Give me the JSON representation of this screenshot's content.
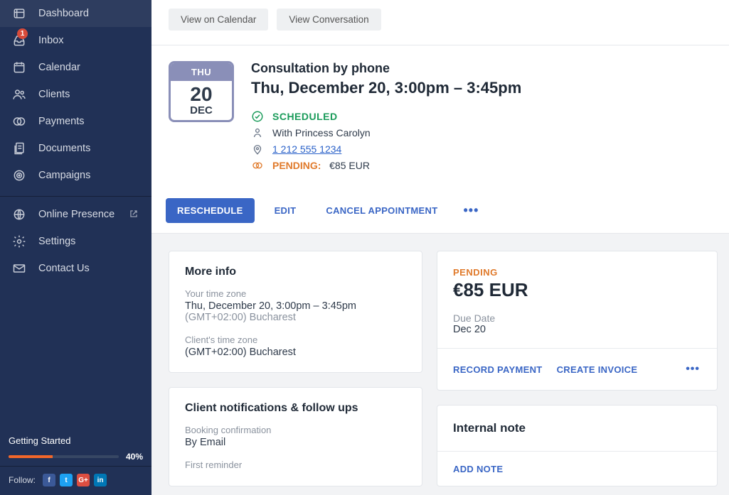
{
  "sidebar": {
    "items": [
      {
        "label": "Dashboard",
        "icon": "dashboard"
      },
      {
        "label": "Inbox",
        "icon": "inbox",
        "badge": "1"
      },
      {
        "label": "Calendar",
        "icon": "calendar"
      },
      {
        "label": "Clients",
        "icon": "clients"
      },
      {
        "label": "Payments",
        "icon": "payments"
      },
      {
        "label": "Documents",
        "icon": "documents"
      },
      {
        "label": "Campaigns",
        "icon": "campaigns"
      }
    ],
    "items2": [
      {
        "label": "Online Presence",
        "icon": "globe",
        "external": true
      },
      {
        "label": "Settings",
        "icon": "settings"
      },
      {
        "label": "Contact Us",
        "icon": "contact"
      }
    ],
    "getting_started": {
      "title": "Getting Started",
      "percent": "40%",
      "pct_num": 40
    },
    "follow_label": "Follow:"
  },
  "top_buttons": {
    "view_calendar": "View on Calendar",
    "view_conversation": "View Conversation"
  },
  "appointment": {
    "calendar": {
      "dow": "THU",
      "day": "20",
      "mon": "DEC"
    },
    "title": "Consultation by phone",
    "datetime": "Thu, December 20, 3:00pm – 3:45pm",
    "status": "SCHEDULED",
    "with_label": "With Princess Carolyn",
    "phone": "1 212 555 1234",
    "pending_label": "PENDING:",
    "pending_amount": "€85 EUR"
  },
  "actions": {
    "reschedule": "RESCHEDULE",
    "edit": "EDIT",
    "cancel": "CANCEL APPOINTMENT"
  },
  "more_info": {
    "heading": "More info",
    "your_tz_label": "Your time zone",
    "your_tz_value": "Thu, December 20, 3:00pm – 3:45pm",
    "your_tz_suffix": "(GMT+02:00) Bucharest",
    "client_tz_label": "Client's time zone",
    "client_tz_value": "(GMT+02:00) Bucharest"
  },
  "notifications": {
    "heading": "Client notifications & follow ups",
    "booking_label": "Booking confirmation",
    "booking_value": "By Email",
    "first_reminder_label": "First reminder"
  },
  "payment_card": {
    "pending": "PENDING",
    "amount": "€85 EUR",
    "due_label": "Due Date",
    "due_value": "Dec 20",
    "record": "RECORD PAYMENT",
    "invoice": "CREATE INVOICE"
  },
  "note_card": {
    "heading": "Internal note",
    "add": "ADD NOTE"
  }
}
